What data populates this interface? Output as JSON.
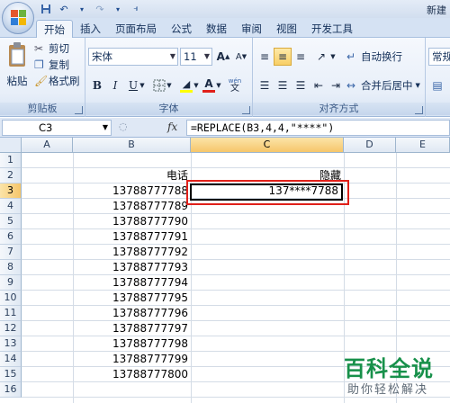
{
  "window": {
    "title": "新建"
  },
  "tabs": [
    "开始",
    "插入",
    "页面布局",
    "公式",
    "数据",
    "审阅",
    "视图",
    "开发工具"
  ],
  "clipboard": {
    "paste": "粘贴",
    "cut": "剪切",
    "copy": "复制",
    "format_painter": "格式刷",
    "label": "剪贴板"
  },
  "font": {
    "name": "宋体",
    "size": "11",
    "bold": "B",
    "italic": "I",
    "underline": "U",
    "font_color_glyph": "A",
    "phonetic": "wén",
    "label": "字体"
  },
  "alignment": {
    "wrap_text": "自动换行",
    "merge_center": "合并后居中",
    "label": "对齐方式"
  },
  "number": {
    "format": "常规"
  },
  "formula_bar": {
    "name_box": "C3",
    "fx": "fx",
    "formula": "=REPLACE(B3,4,4,\"****\")"
  },
  "columns": [
    "A",
    "B",
    "C",
    "D",
    "E"
  ],
  "rows": [
    "1",
    "2",
    "3",
    "4",
    "5",
    "6",
    "7",
    "8",
    "9",
    "10",
    "11",
    "12",
    "13",
    "14",
    "15",
    "16"
  ],
  "headers": {
    "b2": "电话",
    "c2": "隐藏"
  },
  "c3": "137****7788",
  "phones": [
    "13788777788",
    "13788777789",
    "13788777790",
    "13788777791",
    "13788777792",
    "13788777793",
    "13788777794",
    "13788777795",
    "13788777796",
    "13788777797",
    "13788777798",
    "13788777799",
    "13788777800"
  ],
  "watermark": {
    "title": "百科全说",
    "subtitle": "助你轻松解决"
  },
  "colors": {
    "accent": "#e0201a",
    "selection": "#f6c66a",
    "watermark": "#17904a"
  }
}
